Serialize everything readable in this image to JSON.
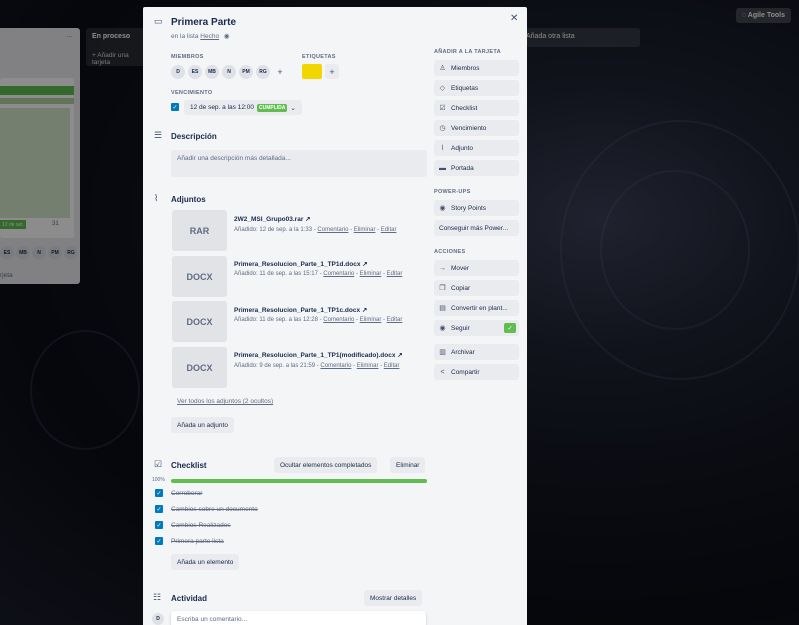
{
  "board": {
    "lists": [
      {
        "title": "En proceso"
      },
      {
        "title": "Añada otra lista"
      }
    ],
    "add_card_label": "Añadir una tarjeta",
    "agile_tools": "Agile Tools",
    "left_card_badge": "12 de set.",
    "left_card_count": "31",
    "left_card_avatars": [
      "ES",
      "MB",
      "N",
      "PM",
      "RG"
    ],
    "left_footer": "rjeta"
  },
  "card": {
    "title": "Primera Parte",
    "in_list_prefix": "en la lista",
    "list_name": "Hecho",
    "members_label": "MIEMBROS",
    "members": [
      "D",
      "ES",
      "MB",
      "N",
      "PM",
      "RG"
    ],
    "labels_label": "ETIQUETAS",
    "label_color": "#f2d600",
    "due_label": "VENCIMIENTO",
    "due_date": "12 de sep. a las 12:00",
    "due_status": "CUMPLIDA",
    "description_title": "Descripción",
    "description_placeholder": "Añadir una descripción más detallada...",
    "attachments_title": "Adjuntos",
    "attachments": [
      {
        "type": "RAR",
        "name": "2W2_MSI_Grupo03.rar",
        "added": "Añadido: 12 de sep. a la 1:33",
        "comment": "Comentario",
        "delete": "Eliminar",
        "edit": "Editar"
      },
      {
        "type": "DOCX",
        "name": "Primera_Resolucion_Parte_1_TP1d.docx",
        "added": "Añadido: 11 de sep. a las 15:17",
        "comment": "Comentario",
        "delete": "Eliminar",
        "edit": "Editar"
      },
      {
        "type": "DOCX",
        "name": "Primera_Resolucion_Parte_1_TP1c.docx",
        "added": "Añadido: 11 de sep. a las 12:28",
        "comment": "Comentario",
        "delete": "Eliminar",
        "edit": "Editar"
      },
      {
        "type": "DOCX",
        "name": "Primera_Resolucion_Parte_1_TP1(modificado).docx",
        "added": "Añadido: 9 de sep. a las 21:59",
        "comment": "Comentario",
        "delete": "Eliminar",
        "edit": "Editar"
      }
    ],
    "view_all_attachments": "Ver todos los adjuntos (2 ocultos)",
    "add_attachment": "Añada un adjunto",
    "checklist_title": "Checklist",
    "hide_completed": "Ocultar elementos completados",
    "delete_checklist": "Eliminar",
    "checklist_progress": "100%",
    "checklist_progress_value": 100,
    "checklist_items": [
      "Corroborar",
      "Cambios sobre un documento",
      "Cambios Realizados",
      "Primera parte lista"
    ],
    "add_item": "Añada un elemento",
    "activity_title": "Actividad",
    "show_details": "Mostrar detalles",
    "comment_placeholder": "Escriba un comentario...",
    "comment_avatar": "D"
  },
  "sidebar": {
    "add_to_card_label": "AÑADIR A LA TARJETA",
    "add_items": [
      {
        "label": "Miembros",
        "icon": "person-icon"
      },
      {
        "label": "Etiquetas",
        "icon": "tag-icon"
      },
      {
        "label": "Checklist",
        "icon": "checklist-icon"
      },
      {
        "label": "Vencimiento",
        "icon": "clock-icon"
      },
      {
        "label": "Adjunto",
        "icon": "paperclip-icon"
      },
      {
        "label": "Portada",
        "icon": "cover-icon"
      }
    ],
    "powerups_label": "POWER-UPS",
    "story_points": "Story Points",
    "get_more_powerups": "Conseguir más Power...",
    "actions_label": "ACCIONES",
    "actions": [
      {
        "label": "Mover",
        "icon": "arrow-right-icon"
      },
      {
        "label": "Copiar",
        "icon": "copy-icon"
      },
      {
        "label": "Convertir en plant...",
        "icon": "template-icon"
      },
      {
        "label": "Seguir",
        "icon": "eye-icon"
      },
      {
        "label": "Archivar",
        "icon": "archive-icon"
      },
      {
        "label": "Compartir",
        "icon": "share-icon"
      }
    ]
  }
}
